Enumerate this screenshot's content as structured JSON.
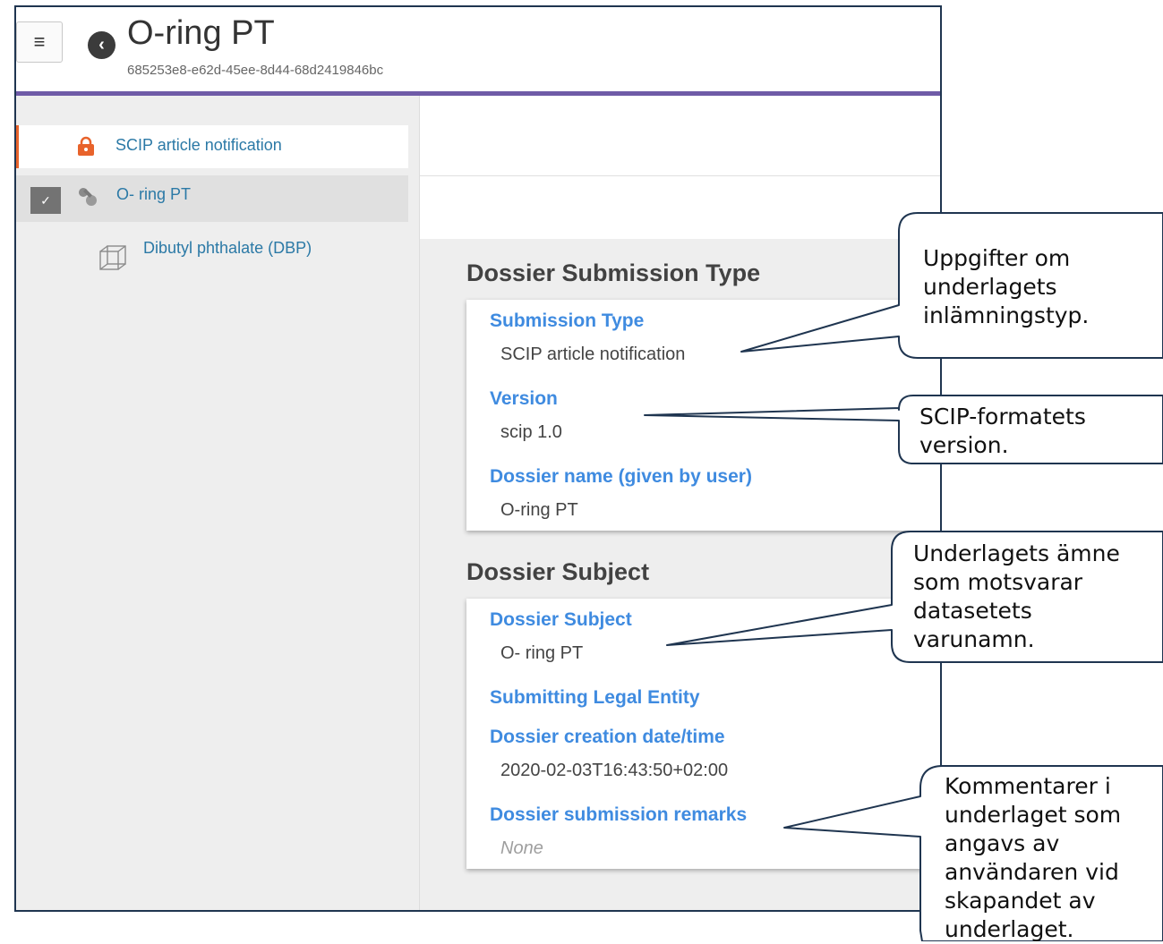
{
  "header": {
    "menu_icon": "menu-arrow-icon",
    "back_icon": "back-circle-icon",
    "title": "O-ring PT",
    "uuid": "685253e8-e62d-45ee-8d44-68d2419846bc",
    "accent_color": "#6f5ba7"
  },
  "sidebar": {
    "items": [
      {
        "label": "SCIP article notification",
        "icon": "lock-icon",
        "icon_color": "#e8632b"
      },
      {
        "label": "O- ring PT",
        "icon": "pin-icon",
        "expander": "chevron-down-icon"
      },
      {
        "label": "Dibutyl phthalate (DBP)",
        "icon": "substance-cube-icon"
      }
    ]
  },
  "main": {
    "sections": [
      {
        "title": "Dossier Submission Type",
        "fields": [
          {
            "label": "Submission Type",
            "value": "SCIP article notification"
          },
          {
            "label": "Version",
            "value": "scip 1.0"
          },
          {
            "label": "Dossier name (given by user)",
            "value": "O-ring PT"
          }
        ]
      },
      {
        "title": "Dossier Subject",
        "fields": [
          {
            "label": "Dossier Subject",
            "value": "O- ring PT"
          },
          {
            "label": "Submitting Legal Entity",
            "value": ""
          },
          {
            "label": "Dossier creation date/time",
            "value": "2020-02-03T16:43:50+02:00"
          },
          {
            "label": "Dossier submission remarks",
            "value": "None"
          }
        ]
      }
    ]
  },
  "callouts": [
    {
      "lines": [
        "Uppgifter om",
        "underlagets",
        "inlämningstyp."
      ]
    },
    {
      "lines": [
        "SCIP-formatets",
        "version."
      ]
    },
    {
      "lines": [
        "Underlagets ämne",
        "som motsvarar",
        "datasetets",
        "varunamn."
      ]
    },
    {
      "lines": [
        "Kommentarer i",
        "underlaget som",
        "angavs av",
        "användaren vid",
        "skapandet av",
        "underlaget."
      ]
    }
  ]
}
